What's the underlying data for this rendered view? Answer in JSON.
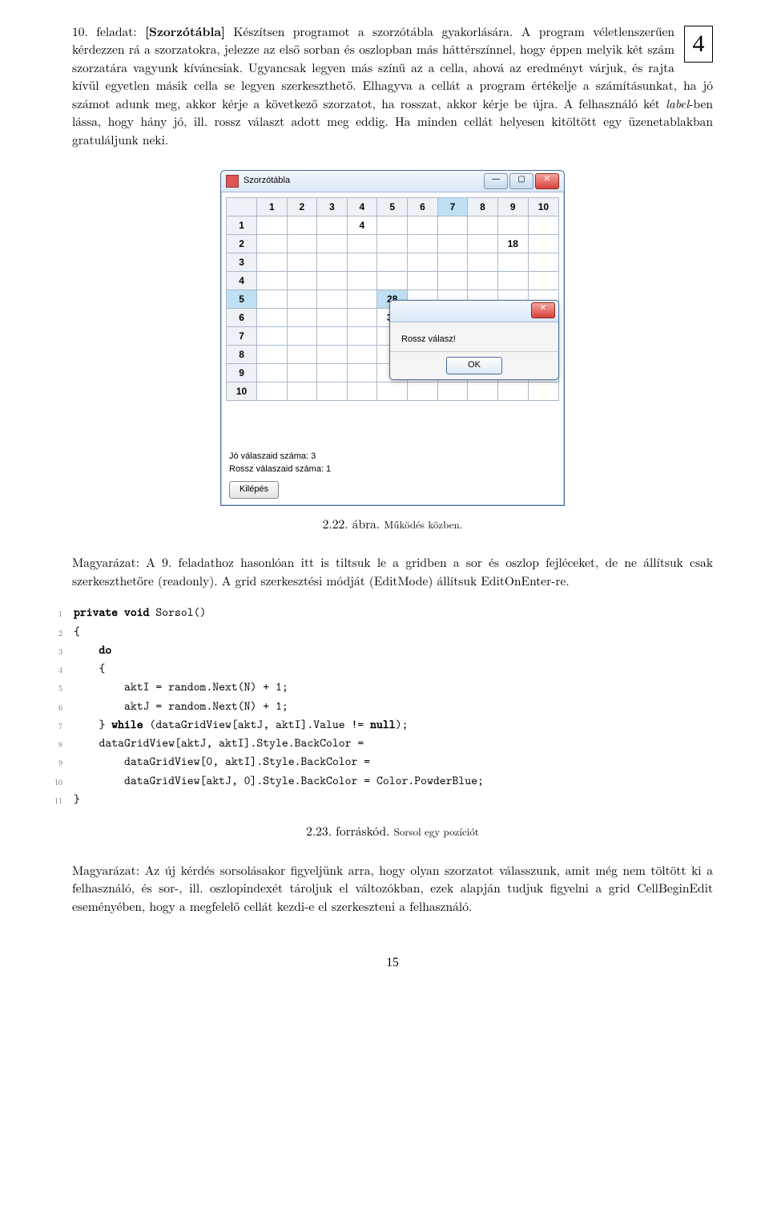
{
  "boxed_number": "4",
  "task": {
    "prefix": "10. feladat: ",
    "title_bold": "[Szorzótábla]",
    "body": " Készítsen programot a szorzótábla gyakorlására. A program véletlenszerűen kérdezzen rá a szorzatokra, jelezze az első sorban és oszlopban más háttérszínnel, hogy éppen melyik két szám szorzatára vagyunk kíváncsiak. Ugyancsak legyen más színű az a cella, ahová az eredményt várjuk, és rajta kívül egyetlen másik cella se legyen szerkeszthető. Elhagyva a cellát a program értékelje a számításunkat, ha jó számot adunk meg, akkor kérje a következő szorzatot, ha rosszat, akkor kérje be újra. A felhasználó két ",
    "label_italic1": "label",
    "body2": "-ben lássa, hogy hány jó, ill. rossz választ adott meg eddig. Ha minden cellát helyesen kitöltött egy üzenetablakban gratuláljunk neki."
  },
  "window": {
    "title": "Szorzótábla",
    "headers": [
      "1",
      "2",
      "3",
      "4",
      "5",
      "6",
      "7",
      "8",
      "9",
      "10"
    ],
    "row_headers": [
      "1",
      "2",
      "3",
      "4",
      "5",
      "6",
      "7",
      "8",
      "9",
      "10"
    ],
    "cells": {
      "r1c4": "4",
      "r2c9": "18",
      "r5c5": "28",
      "r6c5": "30"
    },
    "hl_col": "7",
    "status_good": "Jó válaszaid száma: 3",
    "status_bad": "Rossz válaszaid száma: 1",
    "exit_btn": "Kilépés",
    "dialog_text": "Rossz válasz!",
    "dialog_ok": "OK"
  },
  "caption1": {
    "num": "2.22. ábra. ",
    "txt": "Működés közben."
  },
  "magyarazat1": {
    "lead": "Magyarázat:",
    "body1": "  A 9. feladathoz hasonlóan itt is tiltsuk le a ",
    "it1": "gridben",
    "body2": " a sor és oszlop fejléceket, de ne állítsuk csak szerkeszthetőre ",
    "it2": "(readonly)",
    "body3": ". A ",
    "it3": "grid",
    "body4": " szerkesztési módját ",
    "it4": "(EditMode)",
    "body5": " állítsuk ",
    "it5": "EditOnEnter",
    "body6": "-re."
  },
  "code": {
    "l1": {
      "kw1": "private",
      "sp1": " ",
      "kw2": "void",
      "rest": " Sorsol()"
    },
    "l2": "{",
    "l3": {
      "indent": "    ",
      "kw": "do"
    },
    "l4": "    {",
    "l5": "        aktI = random.Next(N) + 1;",
    "l6": "        aktJ = random.Next(N) + 1;",
    "l7": {
      "p1": "    } ",
      "kw1": "while",
      "p2": " (dataGridView[aktJ, aktI].Value != ",
      "kw2": "null",
      "p3": ");"
    },
    "l8": "    dataGridView[aktJ, aktI].Style.BackColor =",
    "l9": "        dataGridView[0, aktI].Style.BackColor =",
    "l10": "        dataGridView[aktJ, 0].Style.BackColor = Color.PowderBlue;",
    "l11": "}"
  },
  "caption2": {
    "num": "2.23. forráskód. ",
    "txt": "Sorsol egy pozíciót"
  },
  "magyarazat2": {
    "lead": "Magyarázat:",
    "body1": "  Az új kérdés sorsolásakor figyeljünk arra, hogy olyan szorzatot válasszunk, amit még nem töltött ki a felhasználó, és sor-, ill. oszlopindexét tároljuk el változókban, ezek alapján tudjuk figyelni a ",
    "it1": "grid CellBeginEdit",
    "body2": " eseményében, hogy a megfelelő cellát kezdi-e el szerkeszteni a felhasználó."
  },
  "page_number": "15"
}
